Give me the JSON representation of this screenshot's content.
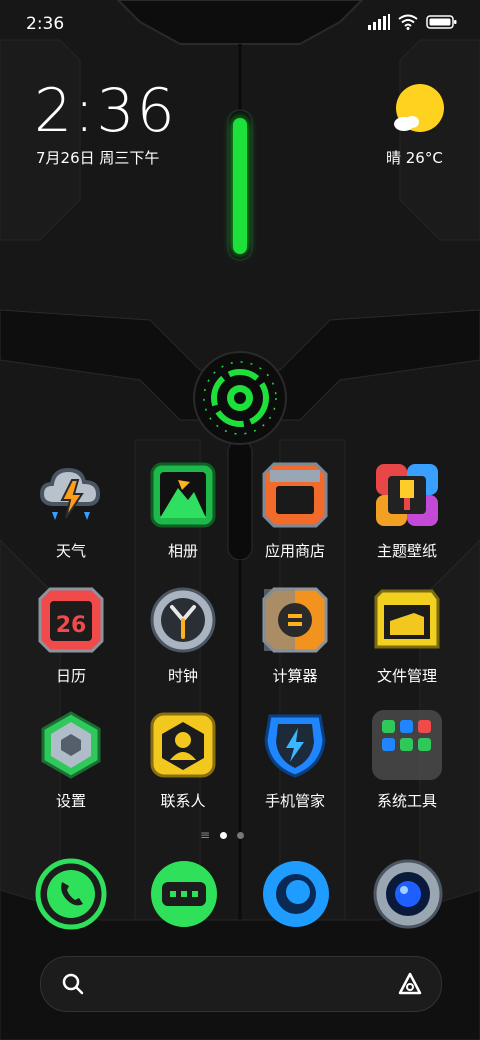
{
  "status_bar": {
    "time": "2:36"
  },
  "clock_widget": {
    "time": "2:36",
    "date": "7月26日 周三下午"
  },
  "weather_widget": {
    "text": "晴 26°C",
    "icon": "sunny-cloud-icon"
  },
  "apps": [
    {
      "label": "天气",
      "icon": "weather-icon"
    },
    {
      "label": "相册",
      "icon": "gallery-icon"
    },
    {
      "label": "应用商店",
      "icon": "app-store-icon"
    },
    {
      "label": "主题壁纸",
      "icon": "themes-icon"
    },
    {
      "label": "日历",
      "icon": "calendar-icon",
      "badge": "26"
    },
    {
      "label": "时钟",
      "icon": "clock-icon"
    },
    {
      "label": "计算器",
      "icon": "calculator-icon"
    },
    {
      "label": "文件管理",
      "icon": "file-manager-icon"
    },
    {
      "label": "设置",
      "icon": "settings-icon"
    },
    {
      "label": "联系人",
      "icon": "contacts-icon"
    },
    {
      "label": "手机管家",
      "icon": "security-icon"
    },
    {
      "label": "系统工具",
      "icon": "system-tools-folder-icon"
    }
  ],
  "dock": [
    {
      "icon": "phone-icon"
    },
    {
      "icon": "messages-icon"
    },
    {
      "icon": "browser-icon"
    },
    {
      "icon": "camera-icon"
    }
  ],
  "colors": {
    "accent_green": "#1ee03a",
    "background": "#151515"
  }
}
